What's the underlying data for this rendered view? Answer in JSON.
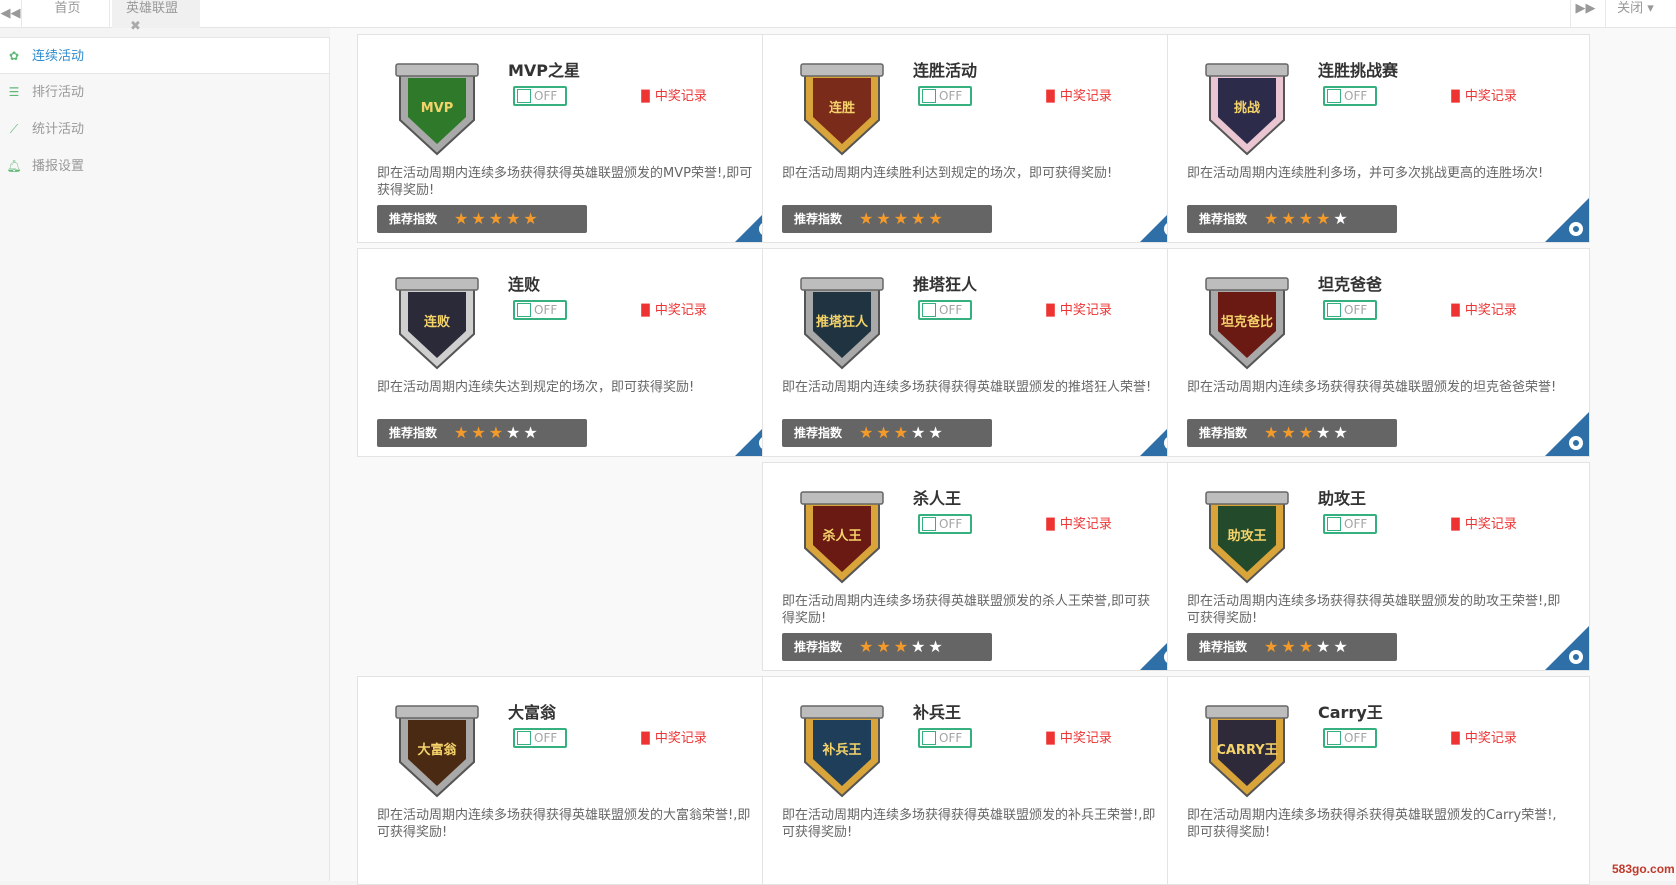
{
  "topbar": {
    "home_tab": "首页",
    "lol_tab": "英雄联盟",
    "close_menu": "关闭"
  },
  "sidebar": {
    "items": [
      {
        "label": "连续活动",
        "icon": "group-icon",
        "active": true
      },
      {
        "label": "排行活动",
        "icon": "list-icon",
        "active": false
      },
      {
        "label": "统计活动",
        "icon": "line-chart-icon",
        "active": false
      },
      {
        "label": "播报设置",
        "icon": "bell-icon",
        "active": false
      }
    ]
  },
  "common": {
    "toggle_off": "OFF",
    "record": "中奖记录",
    "rating_label": "推荐指数"
  },
  "cards": [
    {
      "title": "MVP之星",
      "desc": "即在活动周期内连续多场获得获得英雄联盟颁发的MVP荣誉!,即可获得奖励!",
      "stars": 5,
      "badge_text": "MVP",
      "badge_color": "#2f7a2a",
      "frame": "#a9a9a9"
    },
    {
      "title": "连胜活动",
      "desc": "即在活动周期内连续胜利达到规定的场次，即可获得奖励!",
      "stars": 5,
      "badge_text": "连胜",
      "badge_color": "#7a2b1a",
      "frame": "#d9a53b"
    },
    {
      "title": "连胜挑战赛",
      "desc": "即在活动周期内连续胜利多场，并可多次挑战更高的连胜场次!",
      "stars": 4,
      "badge_text": "挑战",
      "badge_color": "#2c2c4a",
      "frame": "#e9c6d2"
    },
    {
      "title": "连败",
      "desc": "即在活动周期内连续失达到规定的场次，即可获得奖励!",
      "stars": 3,
      "badge_text": "连败",
      "badge_color": "#2a2a38",
      "frame": "#cfcfcf"
    },
    {
      "title": "推塔狂人",
      "desc": "即在活动周期内连续多场获得获得英雄联盟颁发的推塔狂人荣誉!",
      "stars": 3,
      "badge_text": "推塔狂人",
      "badge_color": "#1f3440",
      "frame": "#a9a9a9"
    },
    {
      "title": "坦克爸爸",
      "desc": "即在活动周期内连续多场获得获得英雄联盟颁发的坦克爸爸荣誉!",
      "stars": 3,
      "badge_text": "坦克爸比",
      "badge_color": "#6a1a12",
      "frame": "#a9a9a9"
    },
    {
      "title": "杀人王",
      "desc": "即在活动周期内连续多场获得英雄联盟颁发的杀人王荣誉,即可获得奖励!",
      "stars": 3,
      "badge_text": "杀人王",
      "badge_color": "#6a1a12",
      "frame": "#d9a53b"
    },
    {
      "title": "助攻王",
      "desc": "即在活动周期内连续多场获得获得英雄联盟颁发的助攻王荣誉!,即可获得奖励!",
      "stars": 3,
      "badge_text": "助攻王",
      "badge_color": "#234a2a",
      "frame": "#d9a53b"
    },
    {
      "title": "大富翁",
      "desc": "即在活动周期内连续多场获得获得英雄联盟颁发的大富翁荣誉!,即可获得奖励!",
      "stars": 0,
      "badge_text": "大富翁",
      "badge_color": "#4a2a12",
      "frame": "#a9a9a9"
    },
    {
      "title": "补兵王",
      "desc": "即在活动周期内连续多场获得获得英雄联盟颁发的补兵王荣誉!,即可获得奖励!",
      "stars": 0,
      "badge_text": "补兵王",
      "badge_color": "#1e3e5a",
      "frame": "#d9a53b"
    },
    {
      "title": "Carry王",
      "desc": "即在活动周期内连续多场获得杀获得英雄联盟颁发的Carry荣誉!,即可获得奖励!",
      "stars": 0,
      "badge_text": "CARRY王",
      "badge_color": "#2e2a3a",
      "frame": "#d9a53b"
    }
  ],
  "watermark": "583go.com",
  "colors": {
    "accent_blue": "#2e6fa7",
    "toggle_green": "#35b07e",
    "record_red": "#e33",
    "star_orange": "#f39a2a"
  }
}
